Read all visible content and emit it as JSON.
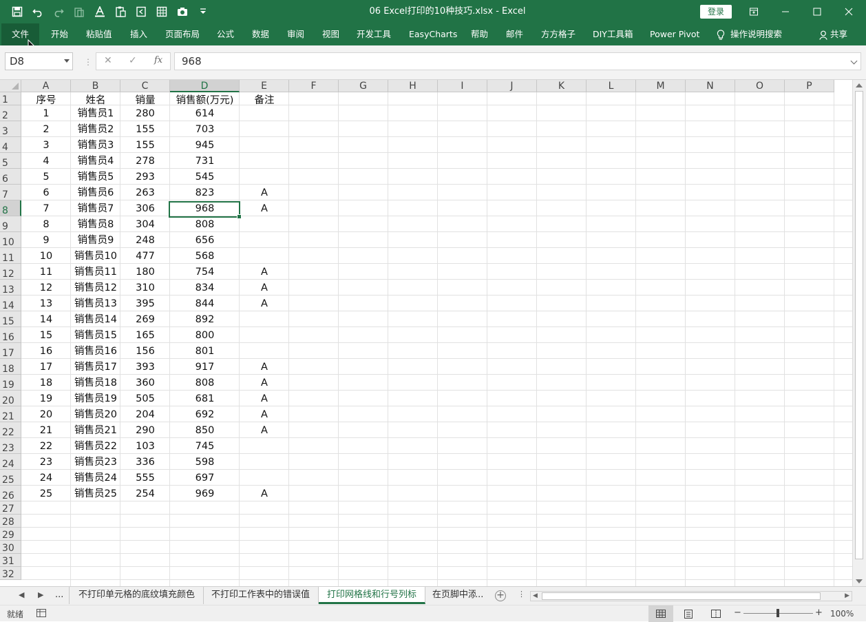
{
  "window": {
    "title": "06 Excel打印的10种技巧.xlsx  -  Excel",
    "login_label": "登录"
  },
  "ribbon": {
    "tabs": [
      "文件",
      "开始",
      "粘贴值",
      "插入",
      "页面布局",
      "公式",
      "数据",
      "审阅",
      "视图",
      "开发工具",
      "EasyCharts",
      "帮助",
      "邮件",
      "方方格子",
      "DIY工具箱",
      "Power Pivot"
    ],
    "tell_me": "操作说明搜索",
    "share": "共享"
  },
  "formula_bar": {
    "name_box": "D8",
    "value": "968",
    "fx_label": "fx"
  },
  "grid": {
    "columns": [
      "A",
      "B",
      "C",
      "D",
      "E",
      "F",
      "G",
      "H",
      "I",
      "J",
      "K",
      "L",
      "M",
      "N",
      "O",
      "P"
    ],
    "selected_column": "D",
    "selected_row": "8",
    "rows": [
      "1",
      "2",
      "3",
      "4",
      "5",
      "6",
      "7",
      "8",
      "9",
      "10",
      "11",
      "12",
      "13",
      "14",
      "15",
      "16",
      "17",
      "18",
      "19",
      "20",
      "21",
      "22",
      "23",
      "24",
      "25",
      "26",
      "27",
      "28",
      "29",
      "30",
      "31",
      "32"
    ],
    "header": [
      "序号",
      "姓名",
      "销量",
      "销售额(万元)",
      "备注"
    ],
    "data": [
      [
        "1",
        "销售员1",
        "280",
        "614",
        ""
      ],
      [
        "2",
        "销售员2",
        "155",
        "703",
        ""
      ],
      [
        "3",
        "销售员3",
        "155",
        "945",
        ""
      ],
      [
        "4",
        "销售员4",
        "278",
        "731",
        ""
      ],
      [
        "5",
        "销售员5",
        "293",
        "545",
        ""
      ],
      [
        "6",
        "销售员6",
        "263",
        "823",
        "A"
      ],
      [
        "7",
        "销售员7",
        "306",
        "968",
        "A"
      ],
      [
        "8",
        "销售员8",
        "304",
        "808",
        ""
      ],
      [
        "9",
        "销售员9",
        "248",
        "656",
        ""
      ],
      [
        "10",
        "销售员10",
        "477",
        "568",
        ""
      ],
      [
        "11",
        "销售员11",
        "180",
        "754",
        "A"
      ],
      [
        "12",
        "销售员12",
        "310",
        "834",
        "A"
      ],
      [
        "13",
        "销售员13",
        "395",
        "844",
        "A"
      ],
      [
        "14",
        "销售员14",
        "269",
        "892",
        ""
      ],
      [
        "15",
        "销售员15",
        "165",
        "800",
        ""
      ],
      [
        "16",
        "销售员16",
        "156",
        "801",
        ""
      ],
      [
        "17",
        "销售员17",
        "393",
        "917",
        "A"
      ],
      [
        "18",
        "销售员18",
        "360",
        "808",
        "A"
      ],
      [
        "19",
        "销售员19",
        "505",
        "681",
        "A"
      ],
      [
        "20",
        "销售员20",
        "204",
        "692",
        "A"
      ],
      [
        "21",
        "销售员21",
        "290",
        "850",
        "A"
      ],
      [
        "22",
        "销售员22",
        "103",
        "745",
        ""
      ],
      [
        "23",
        "销售员23",
        "336",
        "598",
        ""
      ],
      [
        "24",
        "销售员24",
        "555",
        "697",
        ""
      ],
      [
        "25",
        "销售员25",
        "254",
        "969",
        "A"
      ]
    ]
  },
  "sheet_tabs": {
    "ellipsis": "...",
    "tabs": [
      "不打印单元格的底纹填充颜色",
      "不打印工作表中的错误值",
      "打印网格线和行号列标",
      "在页脚中添"
    ],
    "active_index": 2,
    "more": "..."
  },
  "status_bar": {
    "status": "就绪",
    "zoom": "100%",
    "zoom_minus": "−",
    "zoom_plus": "+"
  }
}
